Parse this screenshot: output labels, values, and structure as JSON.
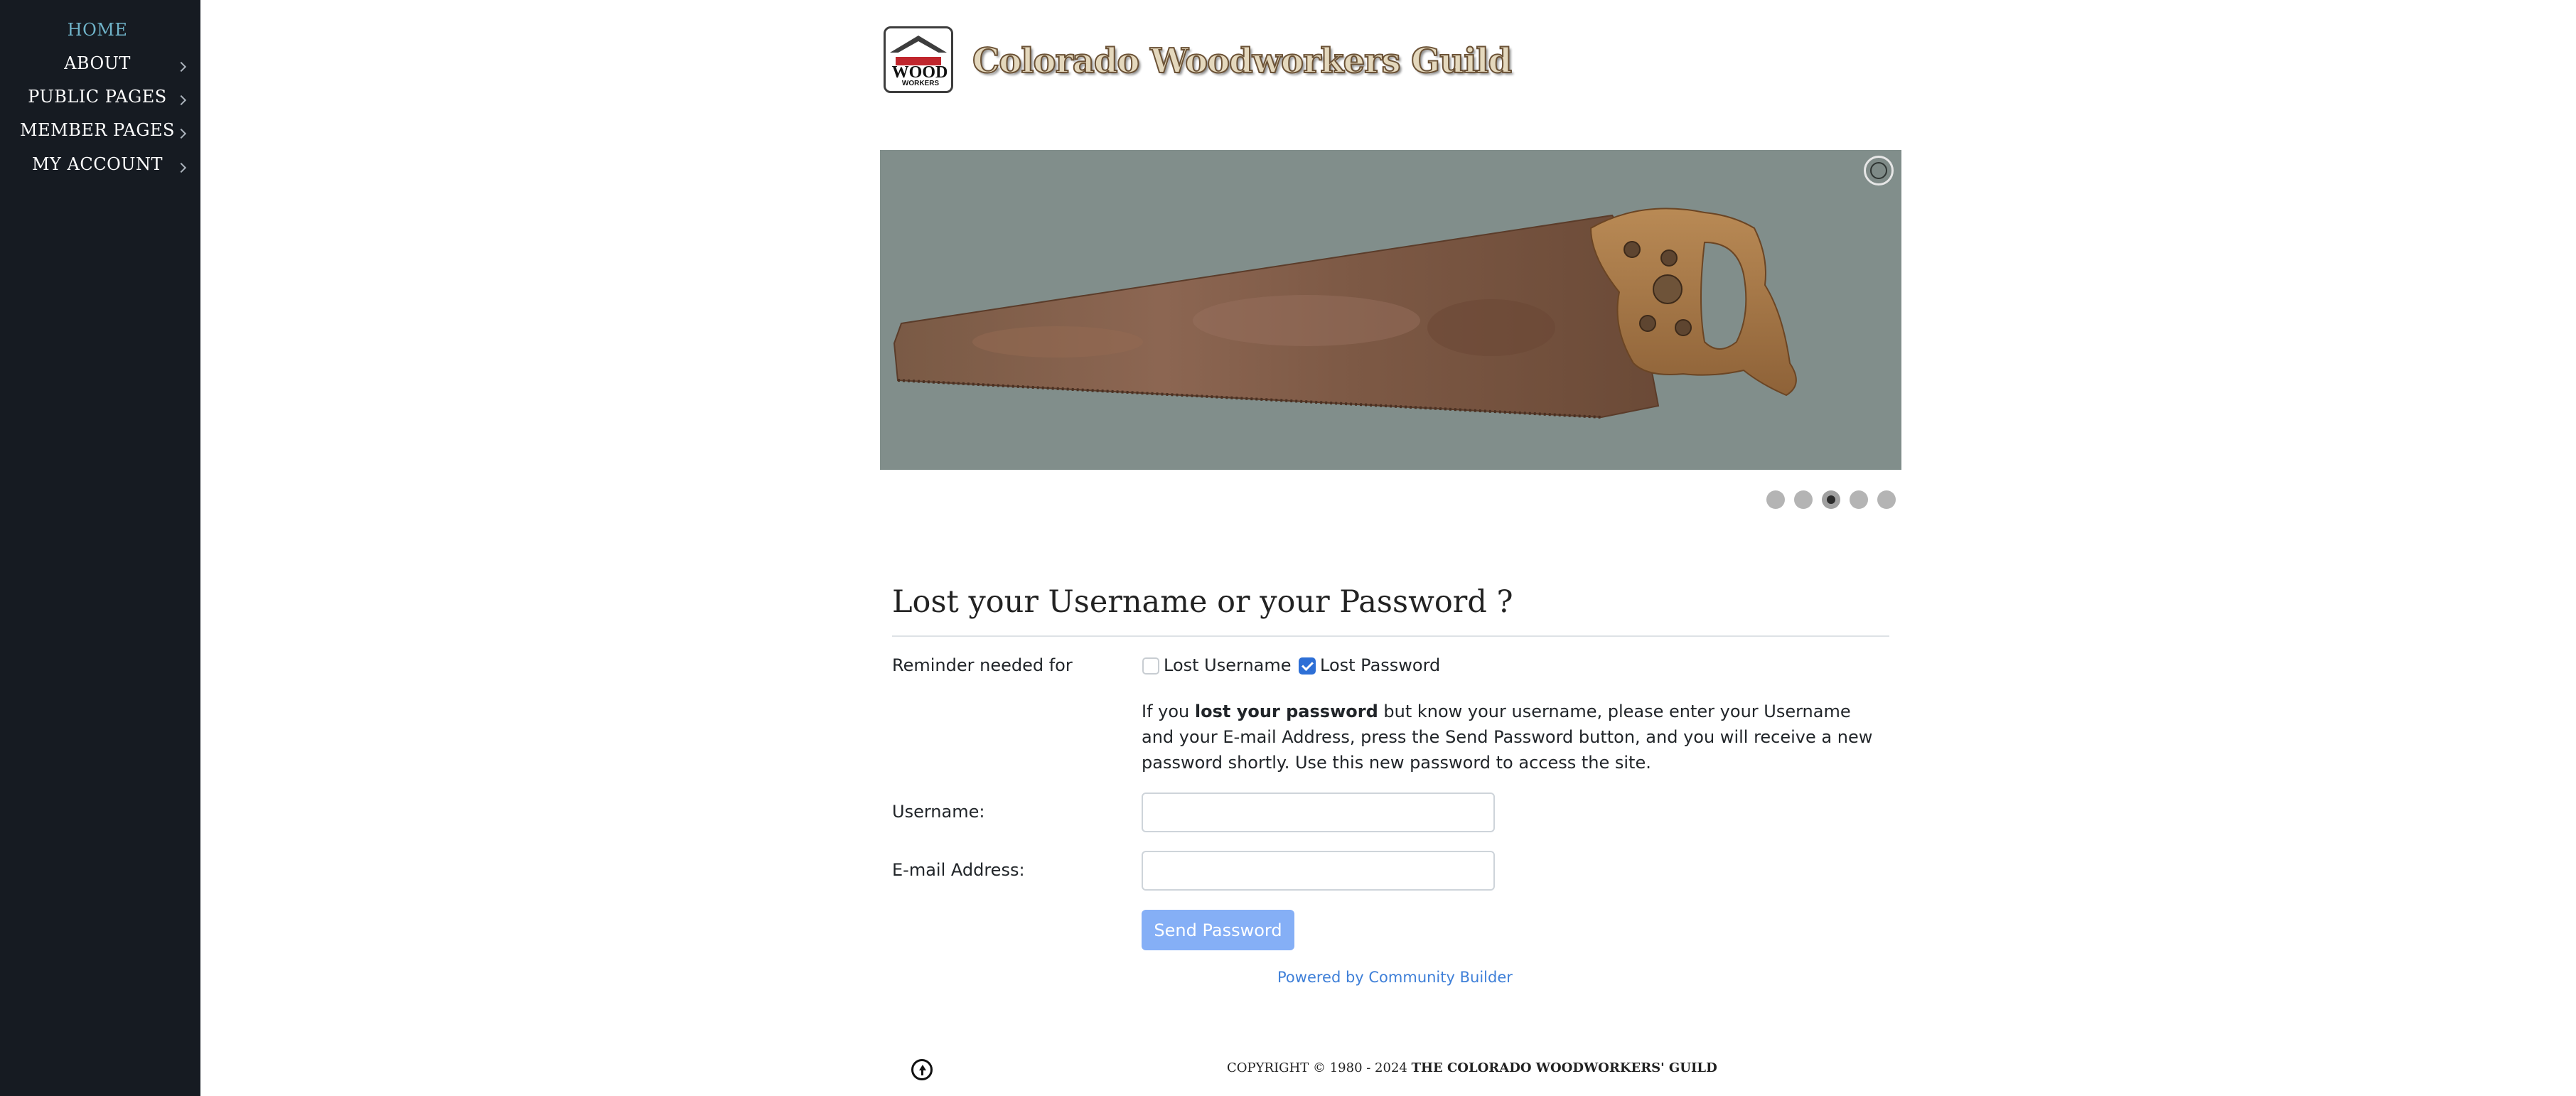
{
  "sidebar": {
    "items": [
      {
        "label": "HOME",
        "active": true
      },
      {
        "label": "ABOUT"
      },
      {
        "label": "PUBLIC PAGES"
      },
      {
        "label": "MEMBER PAGES"
      },
      {
        "label": "MY ACCOUNT"
      }
    ]
  },
  "header": {
    "logo_text": "WOOD",
    "logo_subtext": "WORKERS",
    "site_title": "Colorado Woodworkers Guild"
  },
  "slider": {
    "image": "rusty-hand-saw",
    "slide_count": 5,
    "active_slide": 3
  },
  "form": {
    "heading": "Lost your Username or your Password ?",
    "reminder_label": "Reminder needed for",
    "option_username": "Lost Username",
    "option_password": "Lost Password",
    "option_username_checked": false,
    "option_password_checked": true,
    "help_prefix": "If you ",
    "help_bold": "lost your password",
    "help_suffix": " but know your username, please enter your Username and your E-mail Address, press the Send Password button, and you will receive a new password shortly. Use this new password to access the site.",
    "username_label": "Username:",
    "username_value": "",
    "email_label": "E-mail Address:",
    "email_value": "",
    "submit_label": "Send Password",
    "powered_by": "Powered by Community Builder"
  },
  "footer": {
    "copyright_prefix": "Copyright © 1980 - 2024 ",
    "copyright_org": "The Colorado Woodworkers' Guild"
  },
  "colors": {
    "sidebar_bg": "#161b22",
    "nav_active": "#6fb3c9",
    "slider_bg": "#818e8b",
    "button_bg": "#85aff6",
    "link": "#3e7fd8"
  }
}
